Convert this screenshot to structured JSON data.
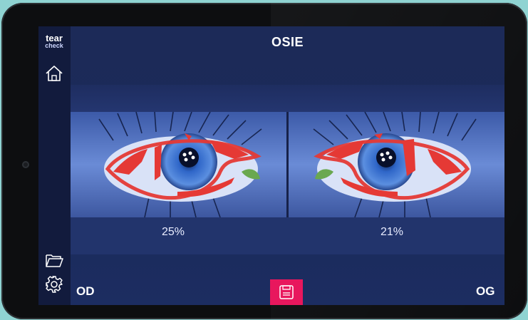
{
  "app": {
    "logo_line1": "tear",
    "logo_line2": "check",
    "title": "OSIE"
  },
  "sidebar": {
    "icons": [
      "home-icon",
      "folder-icon",
      "gear-icon"
    ]
  },
  "eyes": {
    "right": {
      "label": "OD",
      "percentage": "25%"
    },
    "left": {
      "label": "OG",
      "percentage": "21%"
    }
  },
  "footer": {
    "save_icon": "save-icon"
  },
  "colors": {
    "screen_bg": "#1a2a5a",
    "sidebar_bg": "#121b3d",
    "accent": "#e8175d",
    "overlay_red": "#e53935",
    "overlay_green": "#6aa84f",
    "bezel": "#0d0e10",
    "page_bg": "#8fd3d2"
  }
}
